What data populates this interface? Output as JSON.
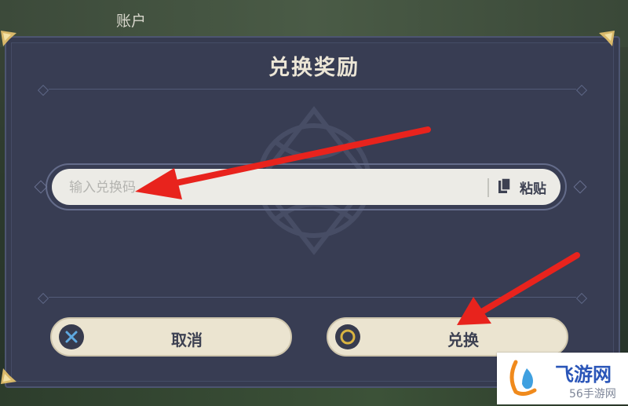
{
  "background": {
    "title": "账户"
  },
  "dialog": {
    "title": "兑换奖励",
    "input": {
      "placeholder": "输入兑换码",
      "value": ""
    },
    "paste_label": "粘贴",
    "cancel_label": "取消",
    "confirm_label": "兑换"
  },
  "icons": {
    "paste": "clipboard-icon",
    "cancel": "cross-button-icon",
    "confirm": "circle-button-icon"
  },
  "annotations": {
    "arrow_color": "#e8231d"
  },
  "watermark": {
    "name": "飞游网",
    "sub": "56手游网"
  },
  "colors": {
    "dialog_bg": "#383d53",
    "button_bg": "#ebe4d0",
    "title_text": "#ece6d6",
    "accent_gold": "#d9b96a",
    "cancel_icon": "#5fa9e0",
    "confirm_icon": "#d9b441"
  }
}
